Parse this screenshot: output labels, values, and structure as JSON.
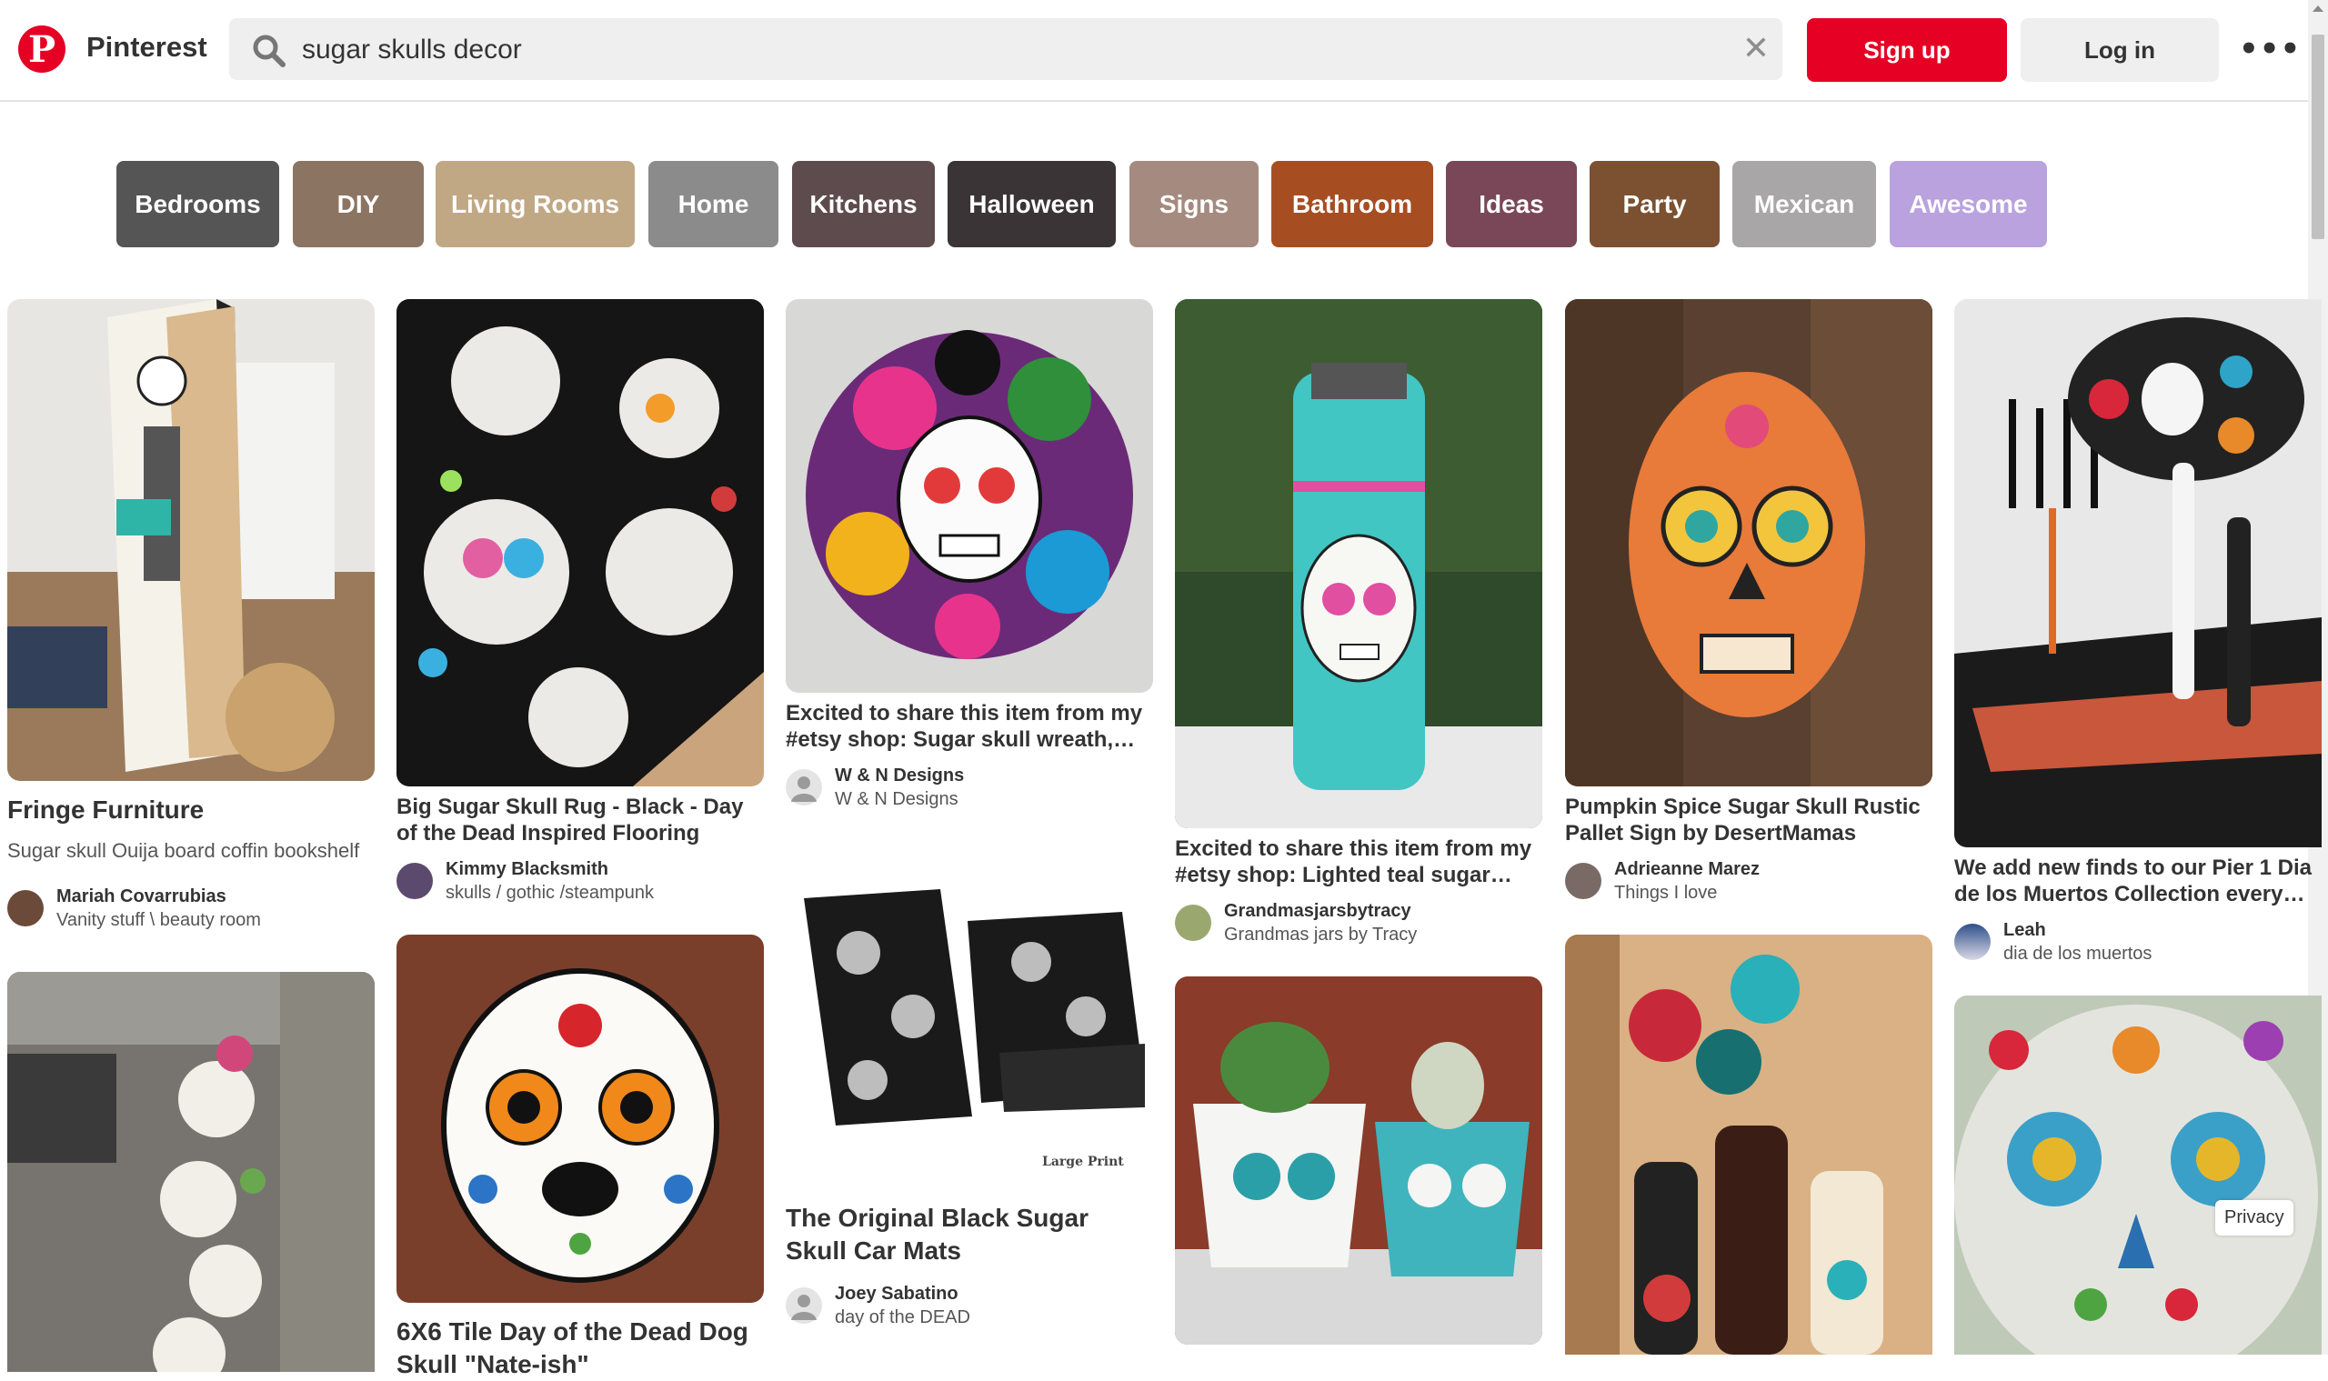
{
  "header": {
    "brand": "Pinterest",
    "search_value": "sugar skulls decor",
    "signup_label": "Sign up",
    "login_label": "Log in",
    "more_label": "•••"
  },
  "guides": [
    {
      "label": "Bedrooms",
      "color": "#555555"
    },
    {
      "label": "DIY",
      "color": "#8c7462"
    },
    {
      "label": "Living Rooms",
      "color": "#c1a884"
    },
    {
      "label": "Home",
      "color": "#8b8b8b"
    },
    {
      "label": "Kitchens",
      "color": "#5e4b4d"
    },
    {
      "label": "Halloween",
      "color": "#3a3436"
    },
    {
      "label": "Signs",
      "color": "#a58a7f"
    },
    {
      "label": "Bathroom",
      "color": "#a64e22"
    },
    {
      "label": "Ideas",
      "color": "#7a4759"
    },
    {
      "label": "Party",
      "color": "#7b5131"
    },
    {
      "label": "Mexican",
      "color": "#a8a6a6"
    },
    {
      "label": "Awesome",
      "color": "#b9a2de"
    }
  ],
  "pins": {
    "p1": {
      "title": "Fringe Furniture",
      "desc": "Sugar skull Ouija board coffin bookshelf",
      "user": "Mariah Covarrubias",
      "board": "Vanity stuff \\ beauty room"
    },
    "p2": {
      "title": "Big Sugar Skull Rug - Black - Day of the Dead Inspired Flooring",
      "user": "Kimmy Blacksmith",
      "board": "skulls / gothic /steampunk"
    },
    "p3": {
      "title": "Excited to share this item from my #etsy shop: Sugar skull wreath, Dia de los Muertos wreath",
      "user": "W & N Designs",
      "board": "W & N Designs"
    },
    "p4": {
      "title": "Excited to share this item from my #etsy shop: Lighted teal sugar skull mason jar",
      "user": "Grandmasjarsbytracy",
      "board": "Grandmas jars by Tracy"
    },
    "p5": {
      "title": "Pumpkin Spice Sugar Skull Rustic Pallet Sign by DesertMamas",
      "user": "Adrieanne Marez",
      "board": "Things I love"
    },
    "p6": {
      "title": "We add new finds to our Pier 1 Dia de los Muertos Collection every year, all season long.",
      "user": "Leah",
      "board": "dia de los muertos"
    },
    "p8": {
      "title": "6X6 Tile Day of the Dead Dog Skull \"Nate-ish\""
    },
    "p9": {
      "title": "The Original Black Sugar Skull Car Mats",
      "user": "Joey Sabatino",
      "board": "day of the DEAD",
      "img_caption": "Large Print"
    }
  },
  "privacy_label": "Privacy"
}
